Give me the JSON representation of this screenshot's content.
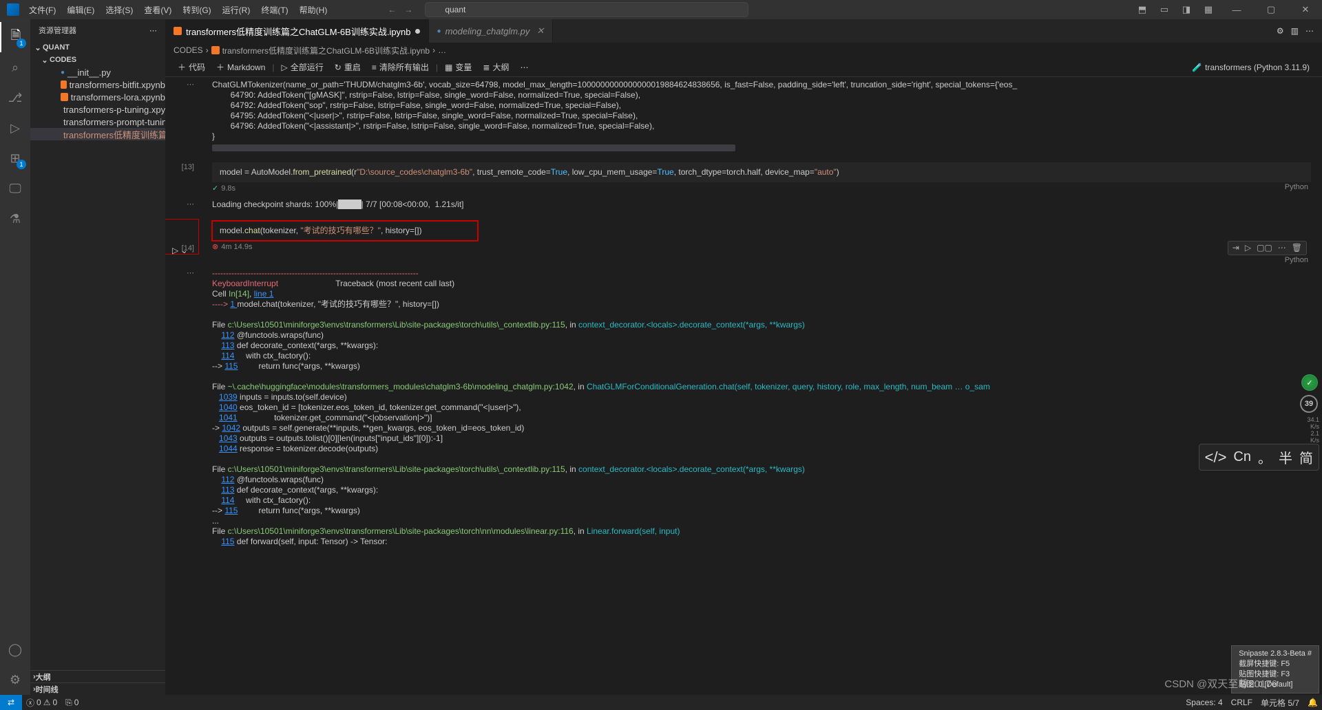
{
  "title_bar": {
    "menus": [
      "文件(F)",
      "编辑(E)",
      "选择(S)",
      "查看(V)",
      "转到(G)",
      "运行(R)",
      "终端(T)",
      "帮助(H)"
    ],
    "search_value": "quant"
  },
  "sidebar": {
    "title": "资源管理器",
    "folder": "QUANT",
    "codes_label": "CODES",
    "files": [
      {
        "name": "__init__.py",
        "icon": "py",
        "modified": false
      },
      {
        "name": "transformers-bitfit.xpynb",
        "icon": "nb",
        "modified": false
      },
      {
        "name": "transformers-lora.xpynb",
        "icon": "nb",
        "modified": false
      },
      {
        "name": "transformers-p-tuning.xpynb",
        "icon": "nb",
        "modified": false
      },
      {
        "name": "transformers-prompt-tuning.xpynb",
        "icon": "nb",
        "modified": false
      },
      {
        "name": "transformers低精度训练篇之ChatG…",
        "icon": "nb",
        "modified": true
      }
    ],
    "outline": "大纲",
    "timeline": "时间线"
  },
  "activity": {
    "badge_ext": "1"
  },
  "tabs": {
    "tab1": "transformers低精度训练篇之ChatGLM-6B训练实战.ipynb",
    "tab2": "modeling_chatglm.py"
  },
  "breadcrumb": {
    "part1": "CODES",
    "part2": "transformers低精度训练篇之ChatGLM-6B训练实战.ipynb",
    "part3": "…"
  },
  "nb_toolbar": {
    "code": "代码",
    "md": "Markdown",
    "runall": "全部运行",
    "restart": "重启",
    "clearout": "清除所有输出",
    "vars": "变量",
    "outline": "大纲",
    "kernel": "transformers (Python 3.11.9)"
  },
  "cells": {
    "out1": "ChatGLMTokenizer(name_or_path='THUDM/chatglm3-6b', vocab_size=64798, model_max_length=1000000000000000019884624838656, is_fast=False, padding_side='left', truncation_side='right', special_tokens={'eos_\n        64790: AddedToken(\"[gMASK]\", rstrip=False, lstrip=False, single_word=False, normalized=True, special=False),\n        64792: AddedToken(\"sop\", rstrip=False, lstrip=False, single_word=False, normalized=True, special=False),\n        64795: AddedToken(\"<|user|>\", rstrip=False, lstrip=False, single_word=False, normalized=True, special=False),\n        64796: AddedToken(\"<|assistant|>\", rstrip=False, lstrip=False, single_word=False, normalized=True, special=False),\n}",
    "cell13_exec_num": "[13]",
    "cell13_time": "9.8s",
    "cell13_lang": "Python",
    "cell13_load": "Loading checkpoint shards: 100%|",
    "cell13_load2": "| 7/7 [00:08<00:00,  1.21s/it]",
    "cell14_run": "▷",
    "cell14_exec_num": "[14]",
    "cell14_time": "4m 14.9s",
    "cell14_lang": "Python"
  },
  "code13": {
    "p": "model = AutoModel.",
    "f": "from_pretrained",
    "a": "(r",
    "s": "\"D:\\source_codes\\chatglm3-6b\"",
    "rest": ", trust_remote_code=",
    "t1": "True",
    "c1": ", low_cpu_mem_usage=",
    "t2": "True",
    "c2": ", torch_dtype=torch.half, device_map=",
    "s2": "\"auto\"",
    "end": ")"
  },
  "code14": {
    "p": "model.",
    "f": "chat",
    "a": "(tokenizer, ",
    "s": "\"考试的技巧有哪些？\"",
    "rest": ", history=[])"
  },
  "traceback": {
    "dash": "---------------------------------------------------------------------------",
    "err": "KeyboardInterrupt",
    "tb": "                         Traceback (most recent call last)",
    "cell": "Cell ",
    "in14": "In[14]",
    ", ": "",
    "line1": "line 1",
    "arrow1": "----> ",
    "one": "1 ",
    "call1": "model.chat(tokenizer, \"考试的技巧有哪些？\", history=[])",
    "file1_pre": "File ",
    "file1": "c:\\Users\\10501\\miniforge3\\envs\\transformers\\Lib\\site-packages\\torch\\utils\\_contextlib.py:115",
    ", in ": "",
    "ctx": "context_decorator.<locals>.decorate_context(*args, **kwargs)",
    "l112": "112",
    "l112t": " @functools.wraps(func)",
    "l113": "113",
    "l113t": " def decorate_context(*args, **kwargs):",
    "l114": "114",
    "l114t": "     with ctx_factory():",
    "arrow2": "--> ",
    "l115": "115",
    "l115t": "         return func(*args, **kwargs)",
    "file2_pre": "File ",
    "file2": "~\\.cache\\huggingface\\modules\\transformers_modules\\chatglm3-6b\\modeling_chatglm.py:1042",
    ", in2": "",
    "glm": "ChatGLMForConditionalGeneration.chat(self, tokenizer, query, history, role, max_length, num_beam … o_sam",
    "l1039": "1039",
    "l1039t": " inputs = inputs.to(self.device)",
    "l1040": "1040",
    "l1040t": " eos_token_id = [tokenizer.eos_token_id, tokenizer.get_command(\"<|user|>\"),",
    "l1041": "1041",
    "l1041t": "                tokenizer.get_command(\"<|observation|>\")]",
    "arrow3": "-> ",
    "l1042": "1042",
    "l1042t": " outputs = self.generate(**inputs, **gen_kwargs, eos_token_id=eos_token_id)",
    "l1043": "1043",
    "l1043t": " outputs = outputs.tolist()[0][len(inputs[\"input_ids\"][0]):-1]",
    "l1044": "1044",
    "l1044t": " response = tokenizer.decode(outputs)",
    "file3_pre": "File ",
    "file3": "c:\\Users\\10501\\miniforge3\\envs\\transformers\\Lib\\site-packages\\torch\\utils\\_contextlib.py:115",
    ", in3": "",
    "ctx3": "context_decorator.<locals>.decorate_context(*args, **kwargs)",
    "dots": "...",
    "file4_pre": "File ",
    "file4": "c:\\Users\\10501\\miniforge3\\envs\\transformers\\Lib\\site-packages\\torch\\nn\\modules\\linear.py:116",
    ", in4": "",
    "lin": "Linear.forward(self, input)",
    "l115b": "115",
    "l115bt": " def forward(self, input: Tensor) -> Tensor:"
  },
  "status": {
    "err": "0",
    "warn": "0",
    "ports": "0",
    "spaces": "Spaces: 4",
    "crlf": "CRLF",
    "cell": "单元格 5/7",
    "bell": "0"
  },
  "overlays": {
    "circ": "39",
    "net1": "34.1",
    "net2": "2.1",
    "unit": "K/s",
    "ime_cn": "Cn",
    "ime_half": "半",
    "ime_simp": "简",
    "snip_title": "Snipaste 2.8.3-Beta #",
    "snip1": "截屏快捷键: F5",
    "snip2": "贴图快捷键: F3",
    "snip3": "贴图: 0 [Default]",
    "watermark": "CSDN @双天至尊20176"
  }
}
